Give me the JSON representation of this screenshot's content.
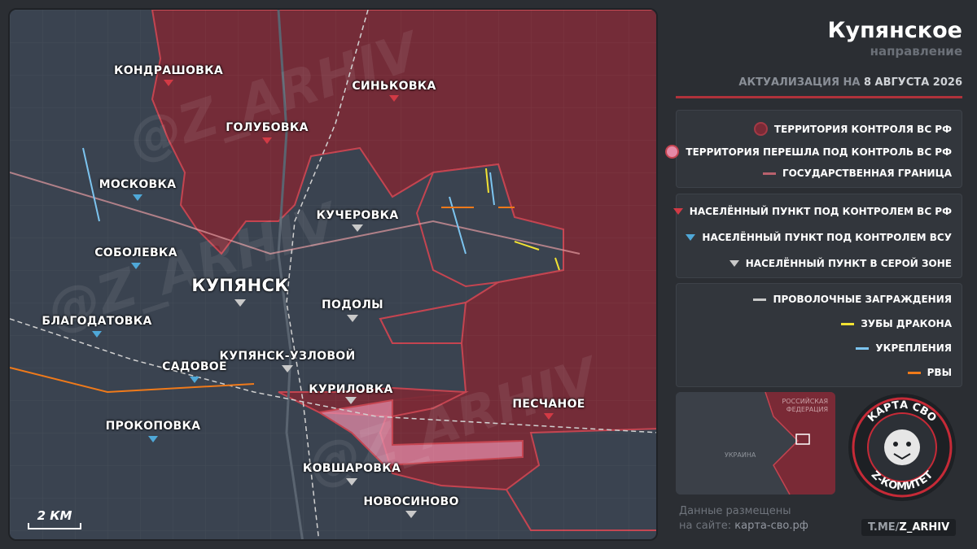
{
  "map": {
    "towns": [
      {
        "id": "kondrashovka",
        "label": "КОНДРАШОВКА",
        "control": "ru"
      },
      {
        "id": "sinkovka",
        "label": "СИНЬКОВКА",
        "control": "ru"
      },
      {
        "id": "golubovka",
        "label": "ГОЛУБОВКА",
        "control": "ru"
      },
      {
        "id": "moskovka",
        "label": "МОСКОВКА",
        "control": "ua"
      },
      {
        "id": "kucherovka",
        "label": "КУЧЕРОВКА",
        "control": "gray"
      },
      {
        "id": "sobolevka",
        "label": "СОБОЛЕВКА",
        "control": "ua"
      },
      {
        "id": "kupyansk",
        "label": "КУПЯНСК",
        "control": "gray"
      },
      {
        "id": "podoly",
        "label": "ПОДОЛЫ",
        "control": "gray"
      },
      {
        "id": "blagodatovka",
        "label": "БЛАГОДАТОВКА",
        "control": "ua"
      },
      {
        "id": "kupyansk-uzlovoy",
        "label": "КУПЯНСК-УЗЛОВОЙ",
        "control": "gray"
      },
      {
        "id": "sadovoe",
        "label": "САДОВОЕ",
        "control": "ua"
      },
      {
        "id": "kurilovka",
        "label": "КУРИЛОВКА",
        "control": "gray"
      },
      {
        "id": "peschanoe",
        "label": "ПЕСЧАНОЕ",
        "control": "ru"
      },
      {
        "id": "prokopovka",
        "label": "ПРОКОПОВКА",
        "control": "ua"
      },
      {
        "id": "kovsharovka",
        "label": "КОВШАРОВКА",
        "control": "gray"
      },
      {
        "id": "novosinovo",
        "label": "НОВОСИНОВО",
        "control": "gray"
      }
    ],
    "watermark": "@Z_ARHIV",
    "scale_label": "2 КМ"
  },
  "panel": {
    "title": "Купянское",
    "subtitle": "направление",
    "update_prefix": "АКТУАЛИЗАЦИЯ НА",
    "update_date": "8 АВГУСТА 2026",
    "legend_territory": [
      {
        "label": "ТЕРРИТОРИЯ КОНТРОЛЯ ВС РФ",
        "color": "#7a2a36"
      },
      {
        "label": "ТЕРРИТОРИЯ ПЕРЕШЛА ПОД КОНТРОЛЬ ВС РФ",
        "color": "#e48aa7"
      },
      {
        "label": "ГОСУДАРСТВЕННАЯ ГРАНИЦА",
        "color": "#b9616d"
      }
    ],
    "legend_settlements": [
      {
        "label": "НАСЕЛЁННЫЙ ПУНКТ ПОД КОНТРОЛЕМ ВС РФ",
        "color": "#d23a45"
      },
      {
        "label": "НАСЕЛЁННЫЙ ПУНКТ ПОД КОНТРОЛЕМ ВСУ",
        "color": "#4fa8d8"
      },
      {
        "label": "НАСЕЛЁННЫЙ ПУНКТ В СЕРОЙ ЗОНЕ",
        "color": "#c9c9c9"
      }
    ],
    "legend_fortifications": [
      {
        "label": "ПРОВОЛОЧНЫЕ ЗАГРАЖДЕНИЯ",
        "color": "#c9c9c9"
      },
      {
        "label": "ЗУБЫ ДРАКОНА",
        "color": "#f2e233"
      },
      {
        "label": "УКРЕПЛЕНИЯ",
        "color": "#7cc4ef"
      },
      {
        "label": "РВЫ",
        "color": "#f07a1a"
      }
    ],
    "inset": {
      "label_ru": "РОССИЙСКАЯ ФЕДЕРАЦИЯ",
      "label_ua": "УКРАИНА"
    },
    "site_note_line1": "Данные размещены",
    "site_note_prefix": "на сайте:",
    "site_note_site": "карта-сво.рф",
    "logo_top": "КАРТА СВО",
    "logo_bottom": "Z-КОМИТЕТ",
    "tg_prefix": "T.ME/",
    "tg_handle": "Z_ARHIV"
  },
  "colors": {
    "ru_territory": "#7a2a36",
    "new_territory": "#e48aa7",
    "ua_territory": "#3a4350",
    "border_line": "#c44450"
  }
}
